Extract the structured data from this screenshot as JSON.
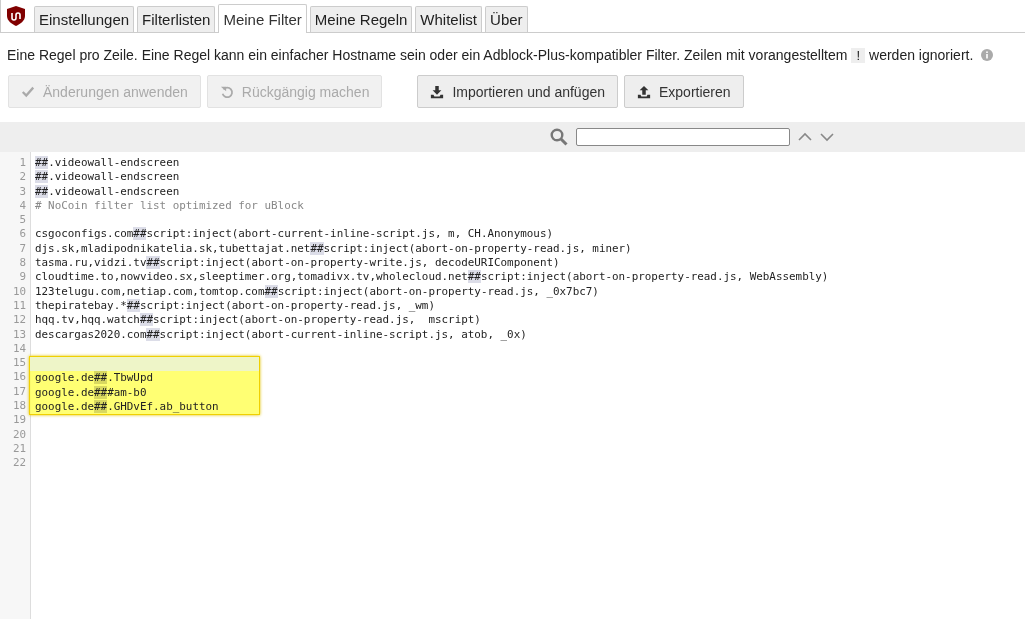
{
  "tabs": [
    {
      "label": "Einstellungen",
      "selected": false
    },
    {
      "label": "Filterlisten",
      "selected": false
    },
    {
      "label": "Meine Filter",
      "selected": true
    },
    {
      "label": "Meine Regeln",
      "selected": false
    },
    {
      "label": "Whitelist",
      "selected": false
    },
    {
      "label": "Über",
      "selected": false
    }
  ],
  "description": {
    "before": "Eine Regel pro Zeile. Eine Regel kann ein einfacher Hostname sein oder ein Adblock-Plus-kompatibler Filter. Zeilen mit vorangestelltem",
    "code": "!",
    "after": "werden ignoriert."
  },
  "buttons": [
    {
      "label": "Änderungen anwenden",
      "disabled": true
    },
    {
      "label": "Rückgängig machen",
      "disabled": true
    },
    {
      "label": "Importieren und anfügen",
      "disabled": false
    },
    {
      "label": "Exportieren",
      "disabled": false
    }
  ],
  "editor": {
    "lines": [
      {
        "number": "1",
        "segments": [
          {
            "kind": "separator",
            "text": "##"
          },
          {
            "kind": "plain",
            "text": ".videowall-endscreen"
          }
        ]
      },
      {
        "number": "2",
        "segments": [
          {
            "kind": "separator",
            "text": "##"
          },
          {
            "kind": "plain",
            "text": ".videowall-endscreen"
          }
        ]
      },
      {
        "number": "3",
        "segments": [
          {
            "kind": "separator",
            "text": "##"
          },
          {
            "kind": "plain",
            "text": ".videowall-endscreen"
          }
        ]
      },
      {
        "number": "4",
        "segments": [
          {
            "kind": "comment",
            "text": "# NoCoin filter list optimized for uBlock"
          }
        ]
      },
      {
        "number": "5"
      },
      {
        "number": "6",
        "segments": [
          {
            "kind": "plain",
            "text": "csgoconfigs.com"
          },
          {
            "kind": "separator",
            "text": "##"
          },
          {
            "kind": "plain",
            "text": "script:inject(abort-current-inline-script.js, m, CH.Anonymous)"
          }
        ]
      },
      {
        "number": "7",
        "segments": [
          {
            "kind": "plain",
            "text": "djs.sk,mladipodnikatelia.sk,tubettajat.net"
          },
          {
            "kind": "separator",
            "text": "##"
          },
          {
            "kind": "plain",
            "text": "script:inject(abort-on-property-read.js, miner)"
          }
        ]
      },
      {
        "number": "8",
        "segments": [
          {
            "kind": "plain",
            "text": "tasma.ru,vidzi.tv"
          },
          {
            "kind": "separator",
            "text": "##"
          },
          {
            "kind": "plain",
            "text": "script:inject(abort-on-property-write.js, decodeURIComponent)"
          }
        ]
      },
      {
        "number": "9",
        "segments": [
          {
            "kind": "plain",
            "text": "cloudtime.to,nowvideo.sx,sleeptimer.org,tomadivx.tv,wholecloud.net"
          },
          {
            "kind": "separator",
            "text": "##"
          },
          {
            "kind": "plain",
            "text": "script:inject(abort-on-property-read.js, WebAssembly)"
          }
        ]
      },
      {
        "number": "10",
        "segments": [
          {
            "kind": "plain",
            "text": "123telugu.com,netiap.com,tomtop.com"
          },
          {
            "kind": "separator",
            "text": "##"
          },
          {
            "kind": "plain",
            "text": "script:inject(abort-on-property-read.js, _0x7bc7)"
          }
        ]
      },
      {
        "number": "11",
        "segments": [
          {
            "kind": "plain",
            "text": "thepiratebay.*"
          },
          {
            "kind": "separator",
            "text": "##"
          },
          {
            "kind": "plain",
            "text": "script:inject(abort-on-property-read.js, _wm)"
          }
        ]
      },
      {
        "number": "12",
        "segments": [
          {
            "kind": "plain",
            "text": "hqq.tv,hqq.watch"
          },
          {
            "kind": "separator",
            "text": "##"
          },
          {
            "kind": "plain",
            "text": "script:inject(abort-on-property-read.js,  mscript)"
          }
        ]
      },
      {
        "number": "13",
        "segments": [
          {
            "kind": "plain",
            "text": "descargas2020.com"
          },
          {
            "kind": "separator",
            "text": "##"
          },
          {
            "kind": "plain",
            "text": "script:inject(abort-current-inline-script.js, atob, _0x)"
          }
        ]
      },
      {
        "number": "14"
      },
      {
        "number": "15",
        "active": true,
        "highlighted": true
      },
      {
        "number": "16",
        "segments": [
          {
            "kind": "plain",
            "text": "google.de"
          },
          {
            "kind": "separator",
            "text": "##"
          },
          {
            "kind": "plain",
            "text": ".TbwUpd"
          }
        ],
        "highlighted": true
      },
      {
        "number": "17",
        "segments": [
          {
            "kind": "plain",
            "text": "google.de"
          },
          {
            "kind": "separator",
            "text": "##"
          },
          {
            "kind": "plain",
            "text": "#am-b0"
          }
        ],
        "highlighted": true
      },
      {
        "number": "18",
        "segments": [
          {
            "kind": "plain",
            "text": "google.de"
          },
          {
            "kind": "separator",
            "text": "##"
          },
          {
            "kind": "plain",
            "text": ".GHDvEf.ab_button"
          }
        ],
        "highlighted": true
      },
      {
        "number": "19"
      },
      {
        "number": "20"
      },
      {
        "number": "21"
      },
      {
        "number": "22"
      }
    ]
  }
}
